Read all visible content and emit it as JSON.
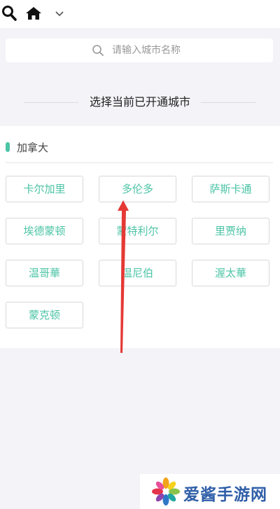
{
  "header": {
    "search_icon": "search-icon",
    "home_icon": "home-icon",
    "dropdown_icon": "chevron-down-icon"
  },
  "search": {
    "placeholder": "请输入城市名称",
    "value": ""
  },
  "section": {
    "title": "选择当前已开通城市"
  },
  "country": {
    "name": "加拿大",
    "accent_color": "#4cc4a6",
    "cities": [
      "卡尔加里",
      "多伦多",
      "萨斯卡通",
      "埃德蒙顿",
      "蒙特利尔",
      "里贾纳",
      "温哥華",
      "温尼伯",
      "渥太華",
      "蒙克顿"
    ]
  },
  "watermark": {
    "text": "爱酱手游网"
  }
}
